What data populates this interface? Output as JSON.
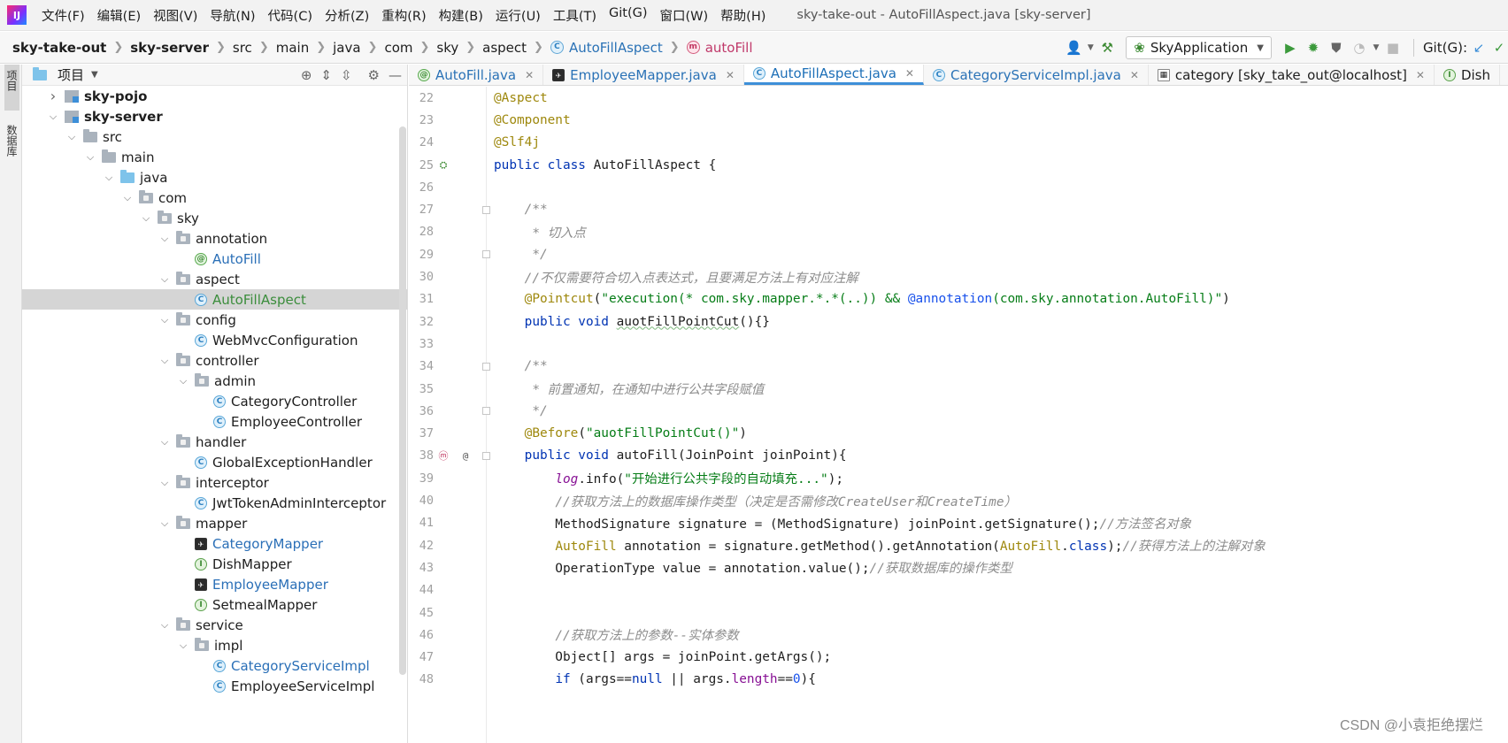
{
  "menu": {
    "items": [
      "文件(F)",
      "编辑(E)",
      "视图(V)",
      "导航(N)",
      "代码(C)",
      "分析(Z)",
      "重构(R)",
      "构建(B)",
      "运行(U)",
      "工具(T)",
      "Git(G)",
      "窗口(W)",
      "帮助(H)"
    ],
    "window_title": "sky-take-out - AutoFillAspect.java [sky-server]"
  },
  "breadcrumb": {
    "items": [
      "sky-take-out",
      "sky-server",
      "src",
      "main",
      "java",
      "com",
      "sky",
      "aspect",
      "AutoFillAspect",
      "autoFill"
    ]
  },
  "toolbar": {
    "run_config": "SkyApplication",
    "git_label": "Git(G):"
  },
  "side_tabs": {
    "project": "项目",
    "database": "数据库"
  },
  "project": {
    "title": "项目",
    "tree": [
      {
        "label": "sky-pojo",
        "indent": 1,
        "arrow": "right",
        "icon": "module",
        "bold": true
      },
      {
        "label": "sky-server",
        "indent": 1,
        "arrow": "down",
        "icon": "module",
        "bold": true
      },
      {
        "label": "src",
        "indent": 2,
        "arrow": "down",
        "icon": "folder"
      },
      {
        "label": "main",
        "indent": 3,
        "arrow": "down",
        "icon": "folder"
      },
      {
        "label": "java",
        "indent": 4,
        "arrow": "down",
        "icon": "folder-blue"
      },
      {
        "label": "com",
        "indent": 5,
        "arrow": "down",
        "icon": "package"
      },
      {
        "label": "sky",
        "indent": 6,
        "arrow": "down",
        "icon": "package"
      },
      {
        "label": "annotation",
        "indent": 7,
        "arrow": "down",
        "icon": "package"
      },
      {
        "label": "AutoFill",
        "indent": 8,
        "arrow": "",
        "icon": "annotation",
        "color": "blue"
      },
      {
        "label": "aspect",
        "indent": 7,
        "arrow": "down",
        "icon": "package"
      },
      {
        "label": "AutoFillAspect",
        "indent": 8,
        "arrow": "",
        "icon": "class",
        "color": "green",
        "selected": true
      },
      {
        "label": "config",
        "indent": 7,
        "arrow": "down",
        "icon": "package"
      },
      {
        "label": "WebMvcConfiguration",
        "indent": 8,
        "arrow": "",
        "icon": "class"
      },
      {
        "label": "controller",
        "indent": 7,
        "arrow": "down",
        "icon": "package"
      },
      {
        "label": "admin",
        "indent": 8,
        "arrow": "down",
        "icon": "package"
      },
      {
        "label": "CategoryController",
        "indent": 9,
        "arrow": "",
        "icon": "class"
      },
      {
        "label": "EmployeeController",
        "indent": 9,
        "arrow": "",
        "icon": "class"
      },
      {
        "label": "handler",
        "indent": 7,
        "arrow": "down",
        "icon": "package"
      },
      {
        "label": "GlobalExceptionHandler",
        "indent": 8,
        "arrow": "",
        "icon": "class"
      },
      {
        "label": "interceptor",
        "indent": 7,
        "arrow": "down",
        "icon": "package"
      },
      {
        "label": "JwtTokenAdminInterceptor",
        "indent": 8,
        "arrow": "",
        "icon": "class"
      },
      {
        "label": "mapper",
        "indent": 7,
        "arrow": "down",
        "icon": "package"
      },
      {
        "label": "CategoryMapper",
        "indent": 8,
        "arrow": "",
        "icon": "mybatis",
        "color": "blue"
      },
      {
        "label": "DishMapper",
        "indent": 8,
        "arrow": "",
        "icon": "interface"
      },
      {
        "label": "EmployeeMapper",
        "indent": 8,
        "arrow": "",
        "icon": "mybatis",
        "color": "blue"
      },
      {
        "label": "SetmealMapper",
        "indent": 8,
        "arrow": "",
        "icon": "interface"
      },
      {
        "label": "service",
        "indent": 7,
        "arrow": "down",
        "icon": "package"
      },
      {
        "label": "impl",
        "indent": 8,
        "arrow": "down",
        "icon": "package"
      },
      {
        "label": "CategoryServiceImpl",
        "indent": 9,
        "arrow": "",
        "icon": "class",
        "color": "blue"
      },
      {
        "label": "EmployeeServiceImpl",
        "indent": 9,
        "arrow": "",
        "icon": "class"
      }
    ]
  },
  "tabs": [
    {
      "label": "AutoFill.java",
      "icon": "annotation"
    },
    {
      "label": "EmployeeMapper.java",
      "icon": "mybatis"
    },
    {
      "label": "AutoFillAspect.java",
      "icon": "class",
      "active": true
    },
    {
      "label": "CategoryServiceImpl.java",
      "icon": "class"
    },
    {
      "label": "category [sky_take_out@localhost]",
      "icon": "table"
    },
    {
      "label": "Dish",
      "icon": "interface"
    }
  ],
  "code": {
    "lines": [
      {
        "n": "22",
        "html": "<span class='an'>@Aspect</span>"
      },
      {
        "n": "23",
        "html": "<span class='an'>@Component</span>"
      },
      {
        "n": "24",
        "html": "<span class='an'>@Slf4j</span>"
      },
      {
        "n": "25",
        "html": "<span class='kw'>public class</span> AutoFillAspect {",
        "gutter": "aspect"
      },
      {
        "n": "26",
        "html": ""
      },
      {
        "n": "27",
        "html": "    <span class='cm'>/**</span>",
        "fold": true
      },
      {
        "n": "28",
        "html": "<span class='cm'>     * 切入点</span>"
      },
      {
        "n": "29",
        "html": "<span class='cm'>     */</span>",
        "fold": true
      },
      {
        "n": "30",
        "html": "    <span class='cm'>//不仅需要符合切入点表达式，且要满足方法上有对应注解</span>"
      },
      {
        "n": "31",
        "html": "    <span class='an'>@Pointcut</span>(<span class='str'>\"execution(* com.sky.mapper.*.*(..)) &amp;&amp; </span><span class='ann-blue'>@annotation</span><span class='str'>(com.sky.annotation.AutoFill)\"</span>)"
      },
      {
        "n": "32",
        "html": "    <span class='kw'>public void</span> <span class='u'>auotFillPointCut</span>(){}"
      },
      {
        "n": "33",
        "html": ""
      },
      {
        "n": "34",
        "html": "    <span class='cm'>/**</span>",
        "fold": true
      },
      {
        "n": "35",
        "html": "<span class='cm'>     * 前置通知，在通知中进行公共字段赋值</span>"
      },
      {
        "n": "36",
        "html": "<span class='cm'>     */</span>",
        "fold": true
      },
      {
        "n": "37",
        "html": "    <span class='an'>@Before</span>(<span class='str'>\"auotFillPointCut()\"</span>)"
      },
      {
        "n": "38",
        "html": "    <span class='kw'>public void</span> autoFill(JoinPoint joinPoint){",
        "gutter": "method",
        "fold": true
      },
      {
        "n": "39",
        "html": "        <span class='fld'>log</span>.info(<span class='str'>\"开始进行公共字段的自动填充...\"</span>);"
      },
      {
        "n": "40",
        "html": "        <span class='cm'>//获取方法上的数据库操作类型（决定是否需修改CreateUser和CreateTime）</span>"
      },
      {
        "n": "41",
        "html": "        MethodSignature signature = (MethodSignature) joinPoint.getSignature();<span class='cm'>//方法签名对象</span>"
      },
      {
        "n": "42",
        "html": "        <span class='cls-ref'>AutoFill</span> annotation = signature.getMethod().getAnnotation(<span class='cls-ref'>AutoFill</span>.<span class='kw'>class</span>);<span class='cm'>//获得方法上的注解对象</span>"
      },
      {
        "n": "43",
        "html": "        OperationType value = annotation.value();<span class='cm'>//获取数据库的操作类型</span>"
      },
      {
        "n": "44",
        "html": ""
      },
      {
        "n": "45",
        "html": ""
      },
      {
        "n": "46",
        "html": "        <span class='cm'>//获取方法上的参数--实体参数</span>"
      },
      {
        "n": "47",
        "html": "        Object[] args = joinPoint.getArgs();"
      },
      {
        "n": "48",
        "html": "        <span class='kw'>if</span> (args==<span class='kw'>null</span> || args.<span class='fld' style='font-style:normal'>length</span>==<span class='ann-blue'>0</span>){"
      }
    ]
  },
  "watermark": "CSDN @小袁拒绝摆烂"
}
